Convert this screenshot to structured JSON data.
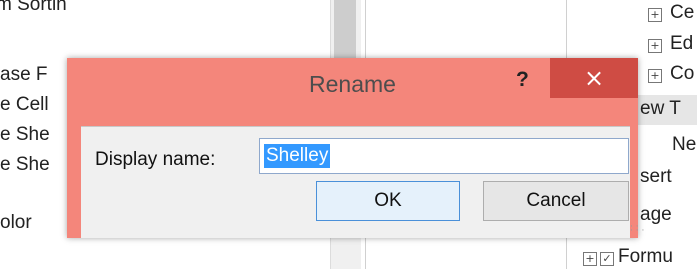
{
  "background": {
    "left_items": [
      "m Sortin",
      "ase F",
      "e Cell",
      "e She",
      "e She",
      "olor"
    ],
    "right_items": [
      "Ce",
      "Ed",
      "Co",
      "ew T",
      "Ne",
      "sert",
      "age",
      "Formu"
    ]
  },
  "dialog": {
    "title": "Rename",
    "help_label": "?",
    "close_label": "×",
    "field_label": "Display name:",
    "field_value": "Shelley",
    "ok_label": "OK",
    "cancel_label": "Cancel"
  },
  "colors": {
    "title_bar": "#f4867b",
    "close_button": "#cf4c44",
    "selection": "#3399ff"
  }
}
